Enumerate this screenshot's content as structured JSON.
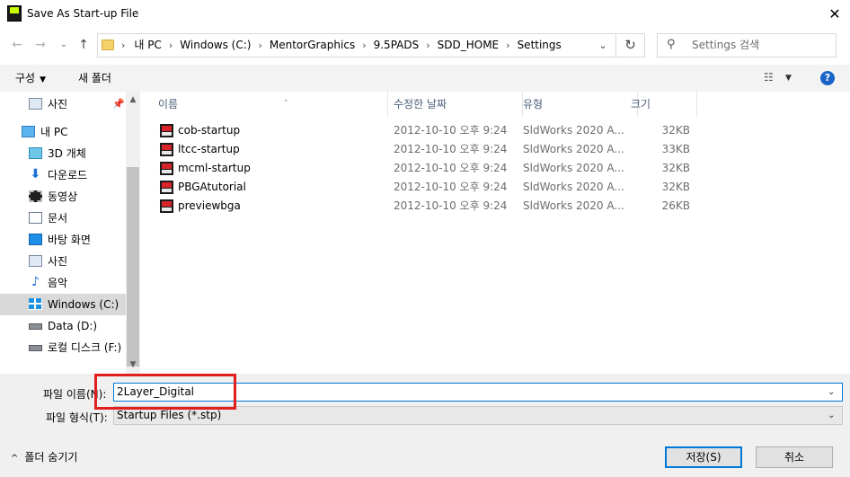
{
  "window": {
    "title": "Save As Start-up File",
    "app_icon_text": "PADS",
    "close_glyph": "✕"
  },
  "nav": {
    "back_glyph": "←",
    "forward_glyph": "→",
    "recent_glyph": "⌄",
    "up_glyph": "↑"
  },
  "address": {
    "crumbs": [
      "내 PC",
      "Windows (C:)",
      "MentorGraphics",
      "9.5PADS",
      "SDD_HOME",
      "Settings"
    ],
    "separator": "›",
    "dropdown_glyph": "⌄",
    "refresh_glyph": "↻"
  },
  "search": {
    "placeholder": "Settings 검색",
    "icon_glyph": "⚲"
  },
  "toolbar": {
    "organize_label": "구성",
    "organize_caret": "▼",
    "new_folder_label": "새 폴더",
    "view_glyph": "☷",
    "view_caret": "▼",
    "help_glyph": "?"
  },
  "sidebar": {
    "pinned_glyph": "📌",
    "items": [
      {
        "label": "사진",
        "icon": "pictures-icon"
      },
      {
        "label": "내 PC",
        "icon": "this-pc-icon"
      },
      {
        "label": "3D 개체",
        "icon": "3d-objects-icon"
      },
      {
        "label": "다운로드",
        "icon": "downloads-icon"
      },
      {
        "label": "동영상",
        "icon": "videos-icon"
      },
      {
        "label": "문서",
        "icon": "documents-icon"
      },
      {
        "label": "바탕 화면",
        "icon": "desktop-icon"
      },
      {
        "label": "사진",
        "icon": "pictures-icon"
      },
      {
        "label": "음악",
        "icon": "music-icon"
      },
      {
        "label": "Windows (C:)",
        "icon": "windows-drive-icon"
      },
      {
        "label": "Data (D:)",
        "icon": "drive-icon"
      },
      {
        "label": "로컬 디스크 (F:)",
        "icon": "drive-icon"
      }
    ],
    "scroll_up_glyph": "▲",
    "scroll_down_glyph": "▼"
  },
  "columns": {
    "name": "이름",
    "date": "수정한 날짜",
    "type": "유형",
    "size": "크기",
    "sort_glyph": "˄"
  },
  "files": [
    {
      "name": "cob-startup",
      "date": "2012-10-10 오후 9:24",
      "type": "SldWorks 2020 A...",
      "size": "32KB"
    },
    {
      "name": "ltcc-startup",
      "date": "2012-10-10 오후 9:24",
      "type": "SldWorks 2020 A...",
      "size": "33KB"
    },
    {
      "name": "mcml-startup",
      "date": "2012-10-10 오후 9:24",
      "type": "SldWorks 2020 A...",
      "size": "32KB"
    },
    {
      "name": "PBGAtutorial",
      "date": "2012-10-10 오후 9:24",
      "type": "SldWorks 2020 A...",
      "size": "32KB"
    },
    {
      "name": "previewbga",
      "date": "2012-10-10 오후 9:24",
      "type": "SldWorks 2020 A...",
      "size": "26KB"
    }
  ],
  "form": {
    "filename_label": "파일 이름(N):",
    "filename_value": "2Layer_Digital",
    "filetype_label": "파일 형식(T):",
    "filetype_value": "Startup Files (*.stp)",
    "dropdown_glyph": "⌄"
  },
  "footer": {
    "hide_folders_caret": "^",
    "hide_folders_label": "폴더 숨기기",
    "save_label": "저장(S)",
    "cancel_label": "취소"
  },
  "colors": {
    "accent": "#0078d7",
    "highlight_box": "#e21d1d",
    "selected_nav": "#d9d9d9"
  }
}
